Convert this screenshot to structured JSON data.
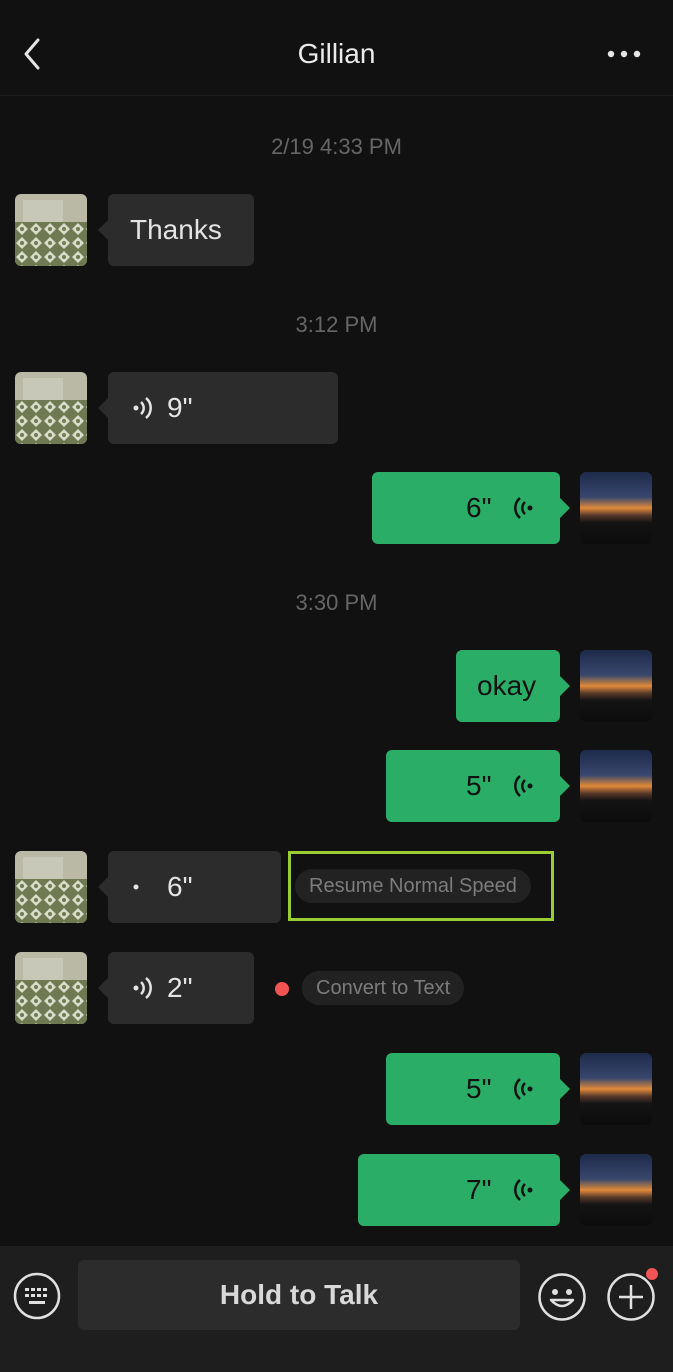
{
  "header": {
    "title": "Gillian",
    "back_icon": "chevron-left-icon",
    "more_icon": "more-horizontal-icon"
  },
  "timestamps": [
    "2/19 4:33 PM",
    "3:12 PM",
    "3:30 PM"
  ],
  "messages": [
    {
      "side": "in",
      "type": "text",
      "text": "Thanks"
    },
    {
      "side": "in",
      "type": "voice",
      "duration": "9\""
    },
    {
      "side": "out",
      "type": "voice",
      "duration": "6\""
    },
    {
      "side": "out",
      "type": "text",
      "text": "okay"
    },
    {
      "side": "out",
      "type": "voice",
      "duration": "5\""
    },
    {
      "side": "in",
      "type": "voice",
      "duration": "6\"",
      "action": "Resume Normal Speed"
    },
    {
      "side": "in",
      "type": "voice",
      "duration": "2\"",
      "action": "Convert to Text",
      "unread": true
    },
    {
      "side": "out",
      "type": "voice",
      "duration": "5\""
    },
    {
      "side": "out",
      "type": "voice",
      "duration": "7\""
    }
  ],
  "input_bar": {
    "hold_label": "Hold to Talk",
    "keyboard_icon": "keyboard-icon",
    "emoji_icon": "emoji-icon",
    "plus_icon": "plus-circle-icon"
  },
  "colors": {
    "background": "#111111",
    "incoming_bubble": "#2c2c2c",
    "outgoing_bubble": "#2aae67",
    "highlight": "#9acd32",
    "unread_dot": "#f25353"
  }
}
